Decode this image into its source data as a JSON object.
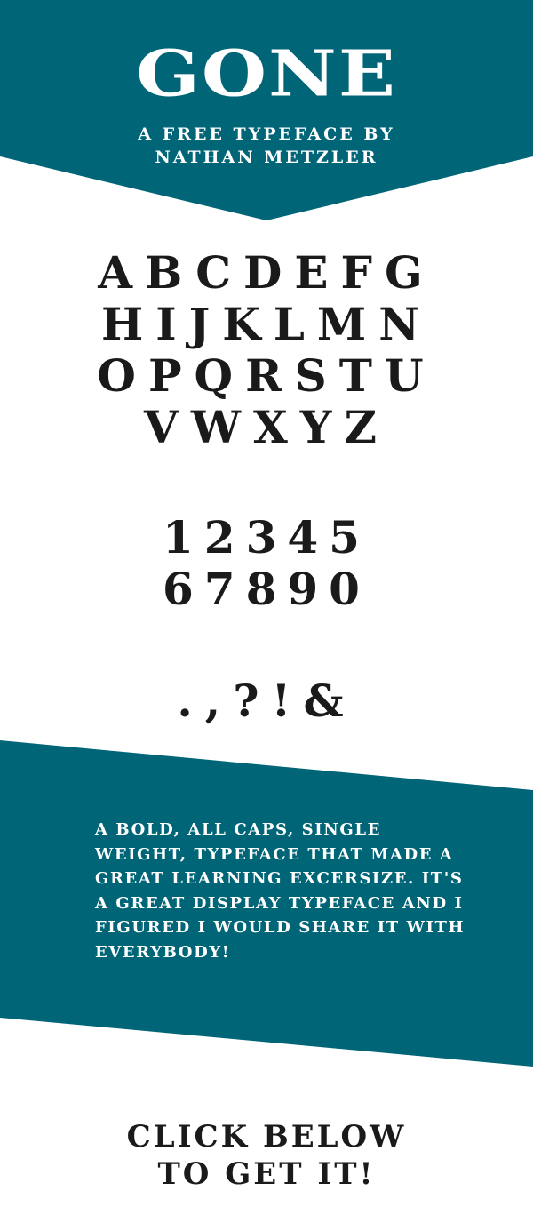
{
  "colors": {
    "teal": "#006577",
    "ink": "#1a1a1a",
    "background": "#ffffff"
  },
  "header": {
    "title": "GONE",
    "subtitle_lines": [
      "A FREE TYPEFACE BY",
      "NATHAN METZLER"
    ]
  },
  "alphabet": {
    "rows": [
      "ABCDEFG",
      "HIJKLMN",
      "OPQRSTU",
      "VWXYZ"
    ]
  },
  "numerals": {
    "rows": [
      "12345",
      "67890"
    ]
  },
  "punctuation": ".,?!&",
  "description": "A BOLD, ALL CAPS, SINGLE WEIGHT, TYPEFACE THAT MADE A GREAT LEARNING EXCERSIZE. IT'S A GREAT DISPLAY TYPEFACE AND I FIGURED I WOULD SHARE IT WITH EVERYBODY!",
  "cta": {
    "lines": [
      "CLICK BELOW",
      "TO GET IT!"
    ]
  }
}
